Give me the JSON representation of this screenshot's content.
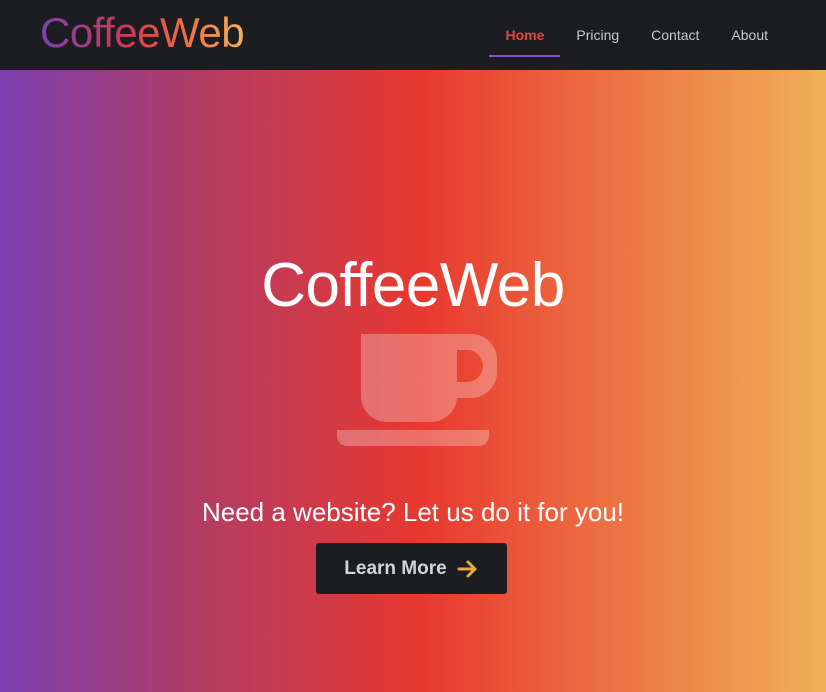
{
  "header": {
    "brand": "CoffeeWeb",
    "nav": [
      {
        "label": "Home",
        "active": true
      },
      {
        "label": "Pricing",
        "active": false
      },
      {
        "label": "Contact",
        "active": false
      },
      {
        "label": "About",
        "active": false
      }
    ]
  },
  "hero": {
    "title": "CoffeeWeb",
    "icon": "coffee-cup-icon",
    "tagline": "Need a website? Let us do it for you!",
    "cta": {
      "label": "Learn More",
      "icon": "arrow-right-icon"
    }
  },
  "colors": {
    "header_bg": "#1b1d20",
    "nav_active": "#e8453a",
    "nav_underline": "#8a4fd2",
    "hero_gradient": [
      "#7b3fb0",
      "#b43c62",
      "#e8382f",
      "#ec6d41",
      "#f1b058"
    ],
    "cta_bg": "#1c1d21",
    "cta_arrow": "#e9a93a"
  }
}
